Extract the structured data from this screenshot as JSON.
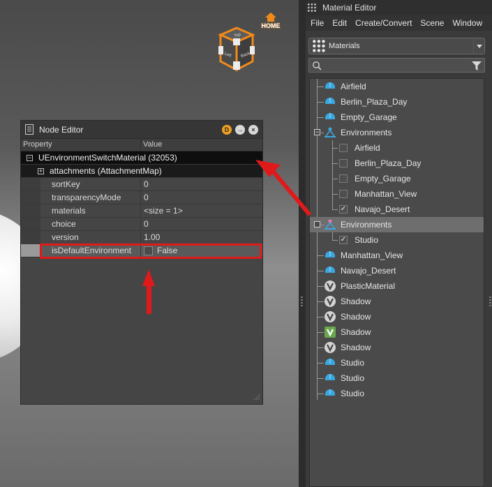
{
  "viewport": {
    "home_label": "HOME",
    "cube_faces": {
      "top": "Top",
      "left": "Left",
      "back": "Back"
    }
  },
  "node_editor": {
    "title": "Node Editor",
    "buttons": [
      "D",
      "→",
      "×"
    ],
    "columns": {
      "property": "Property",
      "value": "Value"
    },
    "root": {
      "label": "UEnvironmentSwitchMaterial (32053)",
      "expander": "−"
    },
    "attachments": {
      "label": "attachments (AttachmentMap)",
      "expander": "+"
    },
    "rows": [
      {
        "property": "sortKey",
        "value": "0"
      },
      {
        "property": "transparencyMode",
        "value": "0"
      },
      {
        "property": "materials",
        "value": "<size = 1>"
      },
      {
        "property": "choice",
        "value": "0"
      },
      {
        "property": "version",
        "value": "1.00"
      }
    ],
    "highlighted_row": {
      "property": "isDefaultEnvironment",
      "value": "False",
      "checked": false
    }
  },
  "material_editor": {
    "title": "Material Editor",
    "menu": [
      "File",
      "Edit",
      "Create/Convert",
      "Scene",
      "Window"
    ],
    "combo": {
      "selected": "Materials"
    },
    "search": {
      "value": "",
      "placeholder": ""
    },
    "tree": [
      {
        "label": "Airfield",
        "icon": "env-icon"
      },
      {
        "label": "Berlin_Plaza_Day",
        "icon": "env-icon"
      },
      {
        "label": "Empty_Garage",
        "icon": "env-icon"
      },
      {
        "label": "Environments",
        "icon": "switch-icon"
      },
      {
        "label": "Airfield",
        "checked": false
      },
      {
        "label": "Berlin_Plaza_Day",
        "checked": false
      },
      {
        "label": "Empty_Garage",
        "checked": false
      },
      {
        "label": "Manhattan_View",
        "checked": false
      },
      {
        "label": "Navajo_Desert",
        "checked": true
      },
      {
        "label": "Environments",
        "icon": "switch-pink-icon"
      },
      {
        "label": "Studio",
        "checked": true
      },
      {
        "label": "Manhattan_View",
        "icon": "env-icon"
      },
      {
        "label": "Navajo_Desert",
        "icon": "env-icon"
      },
      {
        "label": "PlasticMaterial",
        "icon": "v-icon"
      },
      {
        "label": "Shadow",
        "icon": "v-icon"
      },
      {
        "label": "Shadow",
        "icon": "v-icon"
      },
      {
        "label": "Shadow",
        "icon": "v-green-icon"
      },
      {
        "label": "Shadow",
        "icon": "v-icon"
      },
      {
        "label": "Studio",
        "icon": "env-icon"
      },
      {
        "label": "Studio",
        "icon": "env-icon"
      },
      {
        "label": "Studio",
        "icon": "env-icon"
      }
    ]
  },
  "colors": {
    "accent_orange": "#f08a1a",
    "annotation_red": "#e01a1a",
    "env_icon_blue": "#3aa8e0",
    "green_icon": "#6aa84f"
  }
}
